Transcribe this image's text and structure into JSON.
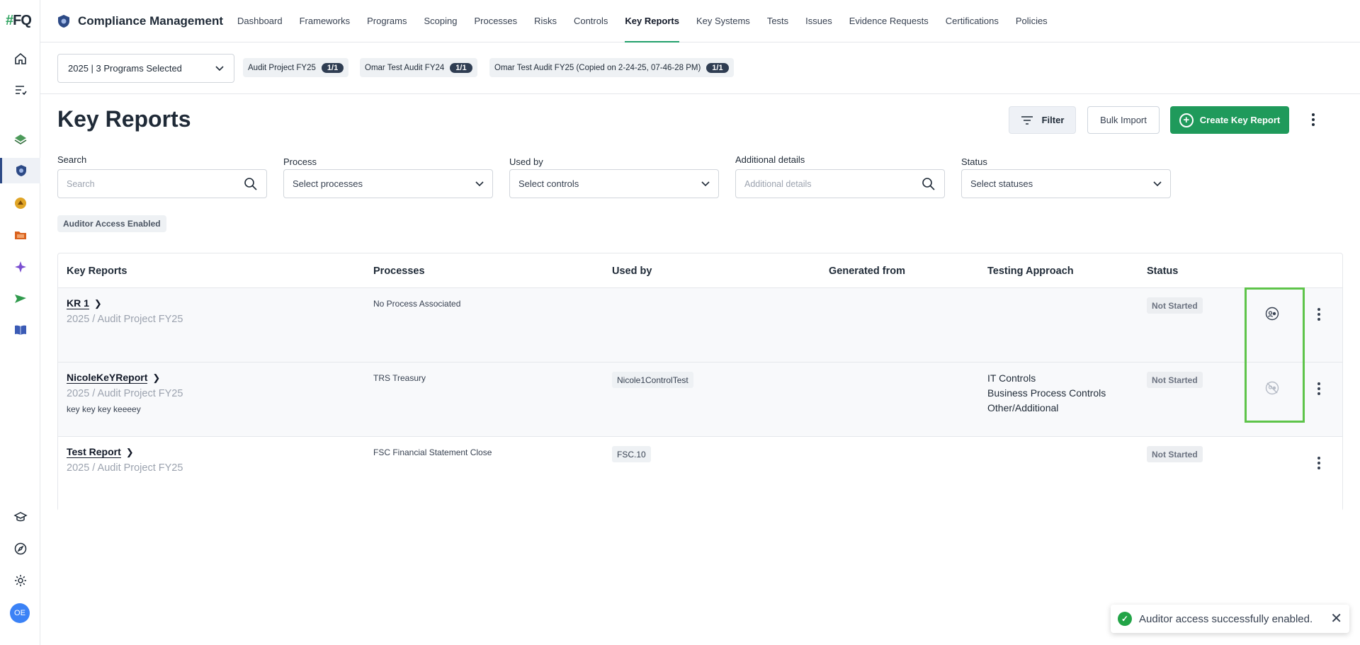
{
  "rail": {
    "logo_hash": "#",
    "logo_text": "FQ",
    "avatar": "OE"
  },
  "app": {
    "title": "Compliance Management"
  },
  "nav": {
    "links": [
      "Dashboard",
      "Frameworks",
      "Programs",
      "Scoping",
      "Processes",
      "Risks",
      "Controls",
      "Key Reports",
      "Key Systems",
      "Tests",
      "Issues",
      "Evidence Requests",
      "Certifications",
      "Policies"
    ],
    "active": "Key Reports"
  },
  "programs": {
    "selector": "2025 | 3 Programs Selected",
    "chips": [
      {
        "label": "Audit Project FY25",
        "count": "1/1"
      },
      {
        "label": "Omar Test Audit FY24",
        "count": "1/1"
      },
      {
        "label": "Omar Test Audit FY25 (Copied on 2-24-25, 07-46-28 PM)",
        "count": "1/1"
      }
    ]
  },
  "header": {
    "title": "Key Reports",
    "filter_label": "Filter",
    "bulk_label": "Bulk Import",
    "create_label": "Create Key Report"
  },
  "filters": {
    "search": {
      "label": "Search",
      "placeholder": "Search"
    },
    "process": {
      "label": "Process",
      "value": "Select processes"
    },
    "used_by": {
      "label": "Used by",
      "value": "Select controls"
    },
    "additional": {
      "label": "Additional details",
      "placeholder": "Additional details"
    },
    "status": {
      "label": "Status",
      "value": "Select statuses"
    },
    "active_tag": "Auditor Access Enabled"
  },
  "table": {
    "columns": [
      "Key Reports",
      "Processes",
      "Used by",
      "Generated from",
      "Testing Approach",
      "Status"
    ],
    "rows": [
      {
        "name": "KR 1",
        "sub": "2025 / Audit Project FY25",
        "desc": "",
        "process": "No Process Associated",
        "used_by": "",
        "approach": [],
        "status": "Not Started",
        "auditor_icon": "auditor-access-enabled-icon"
      },
      {
        "name": "NicoleKeYReport",
        "sub": "2025 / Audit Project FY25",
        "desc": "key key key keeeey",
        "process": "TRS Treasury",
        "used_by": "Nicole1ControlTest",
        "approach": [
          "IT Controls",
          "Business Process Controls",
          "Other/Additional"
        ],
        "status": "Not Started",
        "auditor_icon": "auditor-access-disabled-icon"
      },
      {
        "name": "Test Report",
        "sub": "2025 / Audit Project FY25",
        "desc": "",
        "process": "FSC Financial Statement Close",
        "used_by": "FSC.10",
        "approach": [],
        "status": "Not Started",
        "auditor_icon": ""
      }
    ]
  },
  "toast": {
    "message": "Auditor access successfully enabled."
  },
  "colors": {
    "accent_green": "#1f9a5b",
    "highlight": "#5ec44a",
    "nav_active": "#22a06b"
  }
}
